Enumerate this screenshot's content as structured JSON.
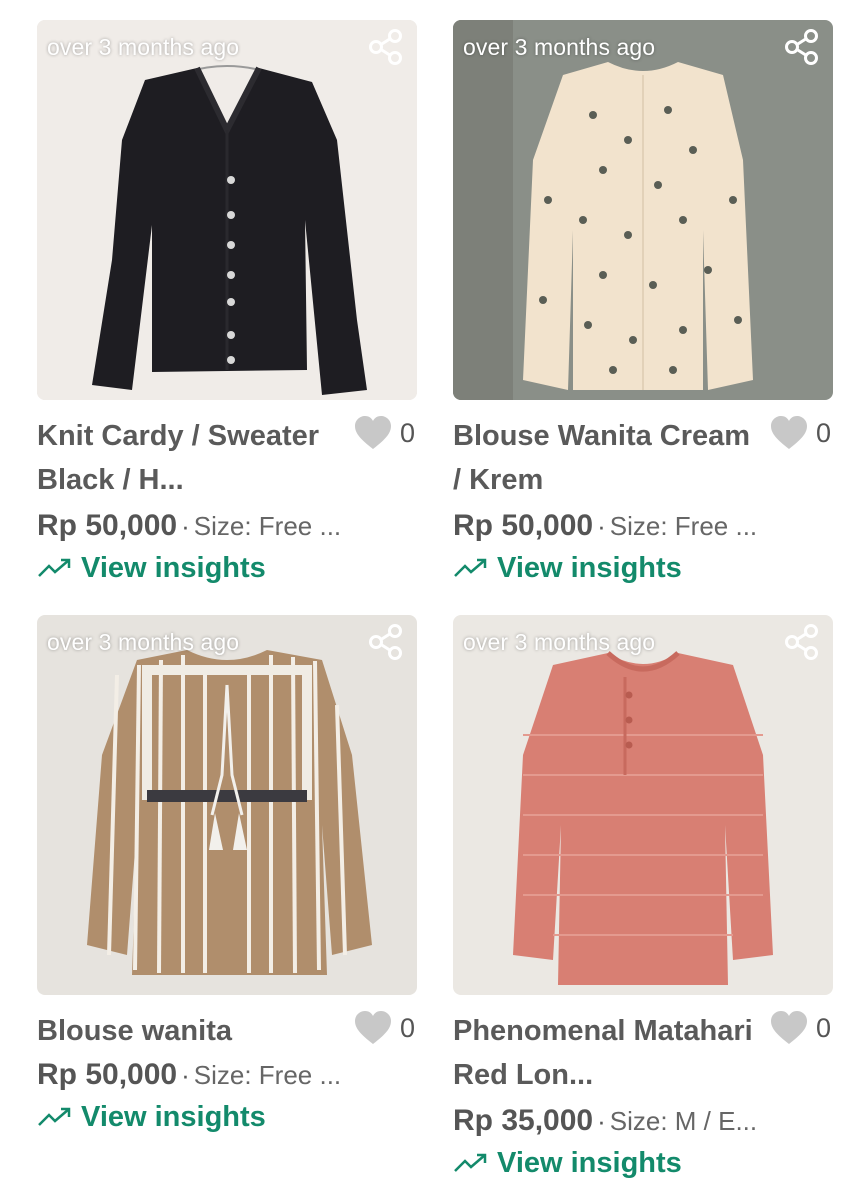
{
  "products": [
    {
      "time": "over 3 months ago",
      "title": "Knit Cardy / Sweater Black / H...",
      "likes": "0",
      "price": "Rp 50,000",
      "separator": "·",
      "size": "Size: Free ...",
      "insights": "View insights",
      "image": "black-cardigan"
    },
    {
      "time": "over 3 months ago",
      "title": "Blouse Wanita Cream / Krem",
      "likes": "0",
      "price": "Rp 50,000",
      "separator": "·",
      "size": "Size: Free ...",
      "insights": "View insights",
      "image": "cream-floral-blouse"
    },
    {
      "time": "over 3 months ago",
      "title": "Blouse wanita",
      "likes": "0",
      "price": "Rp 50,000",
      "separator": "·",
      "size": "Size: Free ...",
      "insights": "View insights",
      "image": "brown-striped-blouse"
    },
    {
      "time": "over 3 months ago",
      "title": "Phenomenal Matahari Red Lon...",
      "likes": "0",
      "price": "Rp 35,000",
      "separator": "·",
      "size": "Size: M / E...",
      "insights": "View insights",
      "image": "red-long-sleeve-top"
    }
  ],
  "icons": {
    "share": "share-icon",
    "like": "heart-icon",
    "insights": "trending-up-icon"
  },
  "colors": {
    "accent": "#138a6b",
    "text": "#555555",
    "heart": "#c8c8c8"
  }
}
